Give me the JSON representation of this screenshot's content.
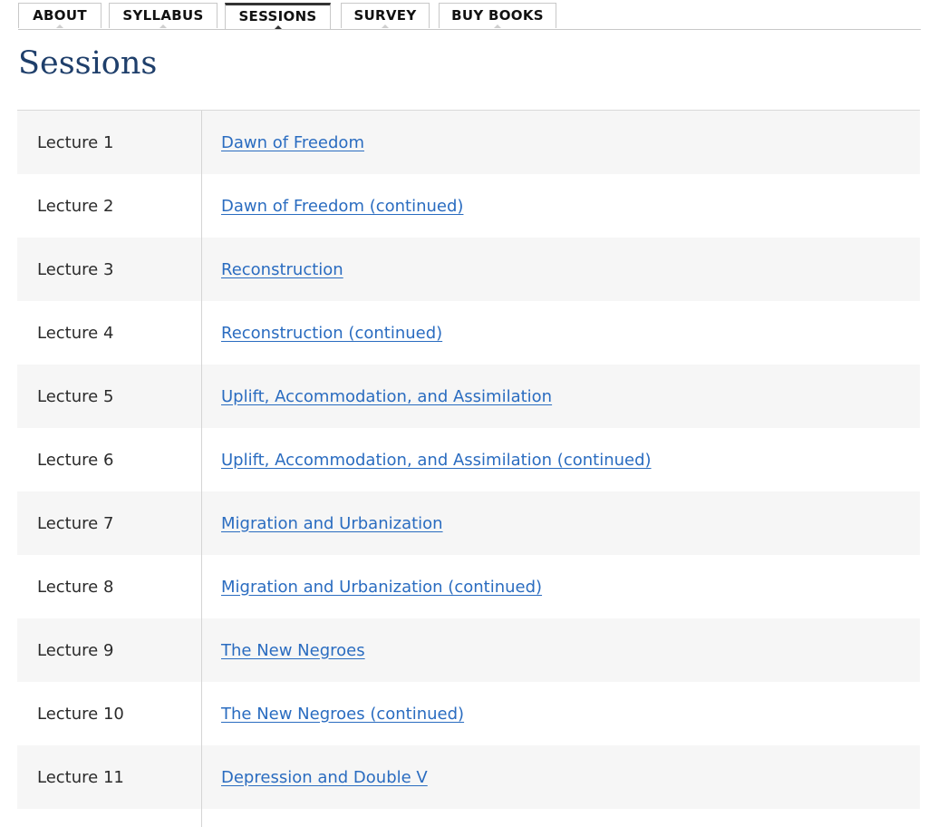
{
  "tabs": [
    {
      "label": "ABOUT",
      "active": false
    },
    {
      "label": "SYLLABUS",
      "active": false
    },
    {
      "label": "SESSIONS",
      "active": true
    },
    {
      "label": "SURVEY",
      "active": false
    },
    {
      "label": "BUY BOOKS",
      "active": false
    }
  ],
  "page_title": "Sessions",
  "sessions": [
    {
      "lecture": "Lecture 1",
      "topic": "Dawn of Freedom"
    },
    {
      "lecture": "Lecture 2",
      "topic": "Dawn of Freedom (continued)"
    },
    {
      "lecture": "Lecture 3",
      "topic": "Reconstruction"
    },
    {
      "lecture": "Lecture 4",
      "topic": "Reconstruction (continued)"
    },
    {
      "lecture": "Lecture 5",
      "topic": "Uplift, Accommodation, and Assimilation"
    },
    {
      "lecture": "Lecture 6",
      "topic": "Uplift, Accommodation, and Assimilation (continued)"
    },
    {
      "lecture": "Lecture 7",
      "topic": "Migration and Urbanization"
    },
    {
      "lecture": "Lecture 8",
      "topic": "Migration and Urbanization (continued)"
    },
    {
      "lecture": "Lecture 9",
      "topic": "The New Negroes"
    },
    {
      "lecture": "Lecture 10",
      "topic": "The New Negroes (continued)"
    },
    {
      "lecture": "Lecture 11",
      "topic": "Depression and Double V"
    }
  ],
  "colors": {
    "title": "#1f3f6b",
    "link": "#2a6cc0",
    "row_shade": "#f6f6f6",
    "active_tab_border": "#333333"
  }
}
